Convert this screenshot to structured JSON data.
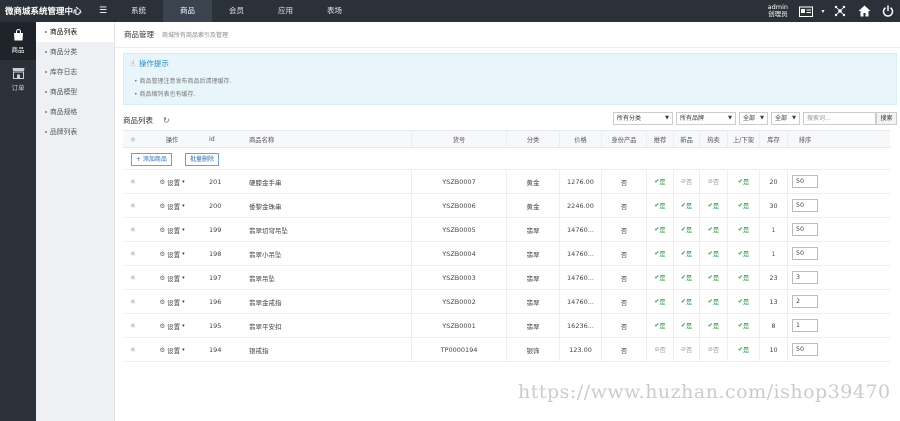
{
  "app": {
    "title": "微商城系统管理中心"
  },
  "topnav": [
    {
      "label": "系统",
      "active": false
    },
    {
      "label": "商品",
      "active": true
    },
    {
      "label": "会员",
      "active": false
    },
    {
      "label": "应用",
      "active": false
    },
    {
      "label": "表场",
      "active": false
    }
  ],
  "user": {
    "name": "admin",
    "role": "创理员"
  },
  "sidebar": [
    {
      "label": "商品",
      "icon": "shopping-bag-icon",
      "active": true
    },
    {
      "label": "订单",
      "icon": "store-icon",
      "active": false
    }
  ],
  "submenu": [
    {
      "label": "商品列表",
      "active": true
    },
    {
      "label": "商品分类",
      "active": false
    },
    {
      "label": "库存日志",
      "active": false
    },
    {
      "label": "商品模型",
      "active": false
    },
    {
      "label": "商品规格",
      "active": false
    },
    {
      "label": "品牌列表",
      "active": false
    }
  ],
  "page": {
    "title": "商品管理",
    "subtitle": "商城所有商品索引及管理"
  },
  "tips": {
    "title": "操作提示",
    "lines": [
      "• 商品管理注意发布商品后清理缓存.",
      "• 商品缩列表也有缓存."
    ]
  },
  "list": {
    "title": "商品列表",
    "filters": {
      "category": "所有分类",
      "brand": "所有品牌",
      "all1": "全部",
      "all2": "全部",
      "search_placeholder": "搜索词...",
      "search_btn": "搜索"
    },
    "add_btn": "+ 添加商品",
    "batch_delete_btn": "批量删除"
  },
  "table": {
    "headers": [
      "操作",
      "id",
      "商品名称",
      "货号",
      "分类",
      "价格",
      "身份产品",
      "推荐",
      "新品",
      "热卖",
      "上/下架",
      "库存",
      "排序"
    ],
    "gear_label": "设置",
    "rows": [
      {
        "id": "201",
        "name": "硬膝金手串",
        "sku": "YSZB0007",
        "category": "黄金",
        "price": "1276.00",
        "identity": "否",
        "recommend": "是",
        "new": "否",
        "hot": "否",
        "onsale": "是",
        "stock": "20",
        "stock_red": false,
        "sort": "50"
      },
      {
        "id": "200",
        "name": "倭黎金珠串",
        "sku": "YSZB0006",
        "category": "黄金",
        "price": "2246.00",
        "identity": "否",
        "recommend": "是",
        "new": "是",
        "hot": "是",
        "onsale": "是",
        "stock": "30",
        "stock_red": false,
        "sort": "50"
      },
      {
        "id": "199",
        "name": "翡翠切穹吊坠",
        "sku": "YSZB0005",
        "category": "翡翠",
        "price": "14760...",
        "identity": "否",
        "recommend": "是",
        "new": "是",
        "hot": "是",
        "onsale": "是",
        "stock": "1",
        "stock_red": true,
        "sort": "50"
      },
      {
        "id": "198",
        "name": "翡翠小吊坠",
        "sku": "YSZB0004",
        "category": "翡翠",
        "price": "14760...",
        "identity": "否",
        "recommend": "是",
        "new": "是",
        "hot": "是",
        "onsale": "是",
        "stock": "1",
        "stock_red": true,
        "sort": "50"
      },
      {
        "id": "197",
        "name": "翡翠吊坠",
        "sku": "YSZB0003",
        "category": "翡翠",
        "price": "14760...",
        "identity": "否",
        "recommend": "是",
        "new": "是",
        "hot": "是",
        "onsale": "是",
        "stock": "23",
        "stock_red": false,
        "sort": "3"
      },
      {
        "id": "196",
        "name": "翡翠金戒指",
        "sku": "YSZB0002",
        "category": "翡翠",
        "price": "14760...",
        "identity": "否",
        "recommend": "是",
        "new": "是",
        "hot": "是",
        "onsale": "是",
        "stock": "13",
        "stock_red": false,
        "sort": "2"
      },
      {
        "id": "195",
        "name": "翡翠平安扣",
        "sku": "YSZB0001",
        "category": "翡翠",
        "price": "16236...",
        "identity": "否",
        "recommend": "是",
        "new": "是",
        "hot": "是",
        "onsale": "是",
        "stock": "8",
        "stock_red": false,
        "sort": "1"
      },
      {
        "id": "194",
        "name": "银戒指",
        "sku": "TP0000194",
        "category": "银饰",
        "price": "123.00",
        "identity": "否",
        "recommend": "否",
        "new": "否",
        "hot": "否",
        "onsale": "是",
        "stock": "10",
        "stock_red": false,
        "sort": "50"
      }
    ]
  },
  "watermark": "https://www.huzhan.com/ishop39470",
  "colors": {
    "topbar": "#2b3139",
    "yes": "#2e9a3e",
    "no": "#999999",
    "accent": "#2a8cc0",
    "danger": "#dd3333"
  }
}
